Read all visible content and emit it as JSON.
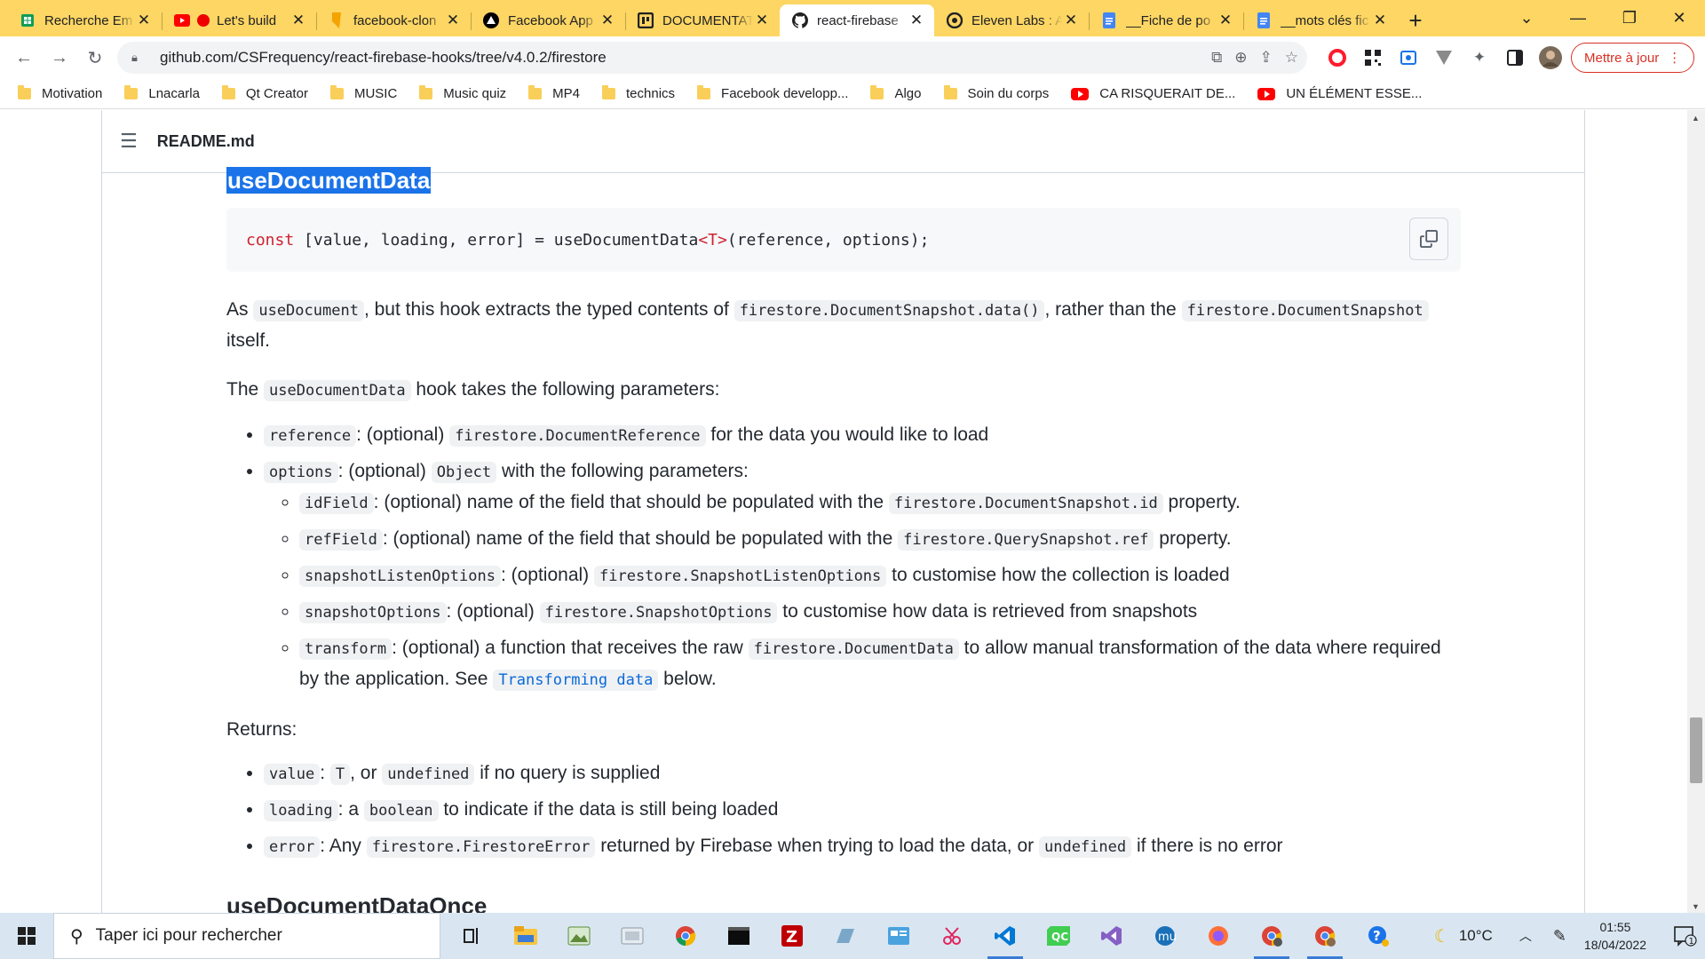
{
  "tabs": [
    {
      "title": "Recherche Em",
      "icon": "google-sheets-icon",
      "color": "#0f9d58"
    },
    {
      "title": "Let's build",
      "icon": "youtube-icon",
      "color": "#ff0000"
    },
    {
      "title": "facebook-clon",
      "icon": "bookmark-icon",
      "color": "#f4a300"
    },
    {
      "title": "Facebook App",
      "icon": "triangle-logo-icon",
      "color": "#000000"
    },
    {
      "title": "DOCUMENTAT",
      "icon": "doc-logo-icon",
      "color": "#202124"
    },
    {
      "title": "react-firebase",
      "icon": "github-icon",
      "color": "#202124",
      "active": true
    },
    {
      "title": "Eleven Labs : A",
      "icon": "elevenlabs-icon",
      "color": "#202124"
    },
    {
      "title": "__Fiche de po",
      "icon": "google-docs-icon",
      "color": "#4285f4"
    },
    {
      "title": "__mots clés fic",
      "icon": "google-docs-icon",
      "color": "#4285f4"
    }
  ],
  "window": {
    "minimize": "⌄",
    "min2": "—",
    "restore": "❐",
    "close": "✕"
  },
  "toolbar": {
    "url": "github.com/CSFrequency/react-firebase-hooks/tree/v4.0.2/firestore",
    "update_label": "Mettre à jour"
  },
  "bookmarks": [
    {
      "label": "Motivation",
      "type": "folder"
    },
    {
      "label": "Lnacarla",
      "type": "folder"
    },
    {
      "label": "Qt Creator",
      "type": "folder"
    },
    {
      "label": "MUSIC",
      "type": "folder"
    },
    {
      "label": "Music quiz",
      "type": "folder"
    },
    {
      "label": "MP4",
      "type": "folder"
    },
    {
      "label": "technics",
      "type": "folder"
    },
    {
      "label": "Facebook developp...",
      "type": "folder"
    },
    {
      "label": "Algo",
      "type": "folder"
    },
    {
      "label": "Soin du corps",
      "type": "folder"
    },
    {
      "label": "CA RISQUERAIT DE...",
      "type": "youtube"
    },
    {
      "label": "UN ÉLÉMENT ESSE...",
      "type": "youtube"
    }
  ],
  "readme": {
    "file": "README.md",
    "heading": "useDocumentData",
    "code": {
      "kw": "const",
      "pre": " [value, loading, error] = useDocumentData",
      "generic": "<T>",
      "post": "(reference, options);"
    },
    "intro": {
      "t1": "As ",
      "c1": "useDocument",
      "t2": ", but this hook extracts the typed contents of ",
      "c2": "firestore.DocumentSnapshot.data()",
      "t3": ", rather than the ",
      "c3": "firestore.DocumentSnapshot",
      "t4": " itself."
    },
    "params_intro": {
      "t1": "The ",
      "c1": "useDocumentData",
      "t2": " hook takes the following parameters:"
    },
    "params": [
      {
        "code": "reference",
        "t1": ": (optional) ",
        "code2": "firestore.DocumentReference",
        "t2": " for the data you would like to load"
      },
      {
        "code": "options",
        "t1": ": (optional) ",
        "code2": "Object",
        "t2": " with the following parameters:"
      }
    ],
    "options": [
      {
        "code": "idField",
        "t1": ": (optional) name of the field that should be populated with the ",
        "code2": "firestore.DocumentSnapshot.id",
        "t2": " property."
      },
      {
        "code": "refField",
        "t1": ": (optional) name of the field that should be populated with the ",
        "code2": "firestore.QuerySnapshot.ref",
        "t2": " property."
      },
      {
        "code": "snapshotListenOptions",
        "t1": ": (optional) ",
        "code2": "firestore.SnapshotListenOptions",
        "t2": " to customise how the collection is loaded"
      },
      {
        "code": "snapshotOptions",
        "t1": ": (optional) ",
        "code2": "firestore.SnapshotOptions",
        "t2": " to customise how data is retrieved from snapshots"
      }
    ],
    "transform": {
      "code": "transform",
      "t1": ": (optional) a function that receives the raw ",
      "code2": "firestore.DocumentData",
      "t2": " to allow manual transformation of the data where required by the application. See ",
      "link": "Transforming data",
      "t3": " below."
    },
    "returns_label": "Returns:",
    "returns": {
      "value": {
        "c1": "value",
        "t1": ": ",
        "c2": "T",
        "t2": ", or ",
        "c3": "undefined",
        "t3": " if no query is supplied"
      },
      "loading": {
        "c1": "loading",
        "t1": ": a ",
        "c2": "boolean",
        "t2": " to indicate if the data is still being loaded"
      },
      "error": {
        "c1": "error",
        "t1": ": Any ",
        "c2": "firestore.FirestoreError",
        "t2": " returned by Firebase when trying to load the data, or ",
        "c3": "undefined",
        "t3": " if there is no error"
      }
    },
    "next_heading": "useDocumentDataOnce"
  },
  "taskbar": {
    "search_placeholder": "Taper ici pour rechercher",
    "temperature": "10°C",
    "time": "01:55",
    "date": "18/04/2022",
    "notification_count": "1"
  }
}
